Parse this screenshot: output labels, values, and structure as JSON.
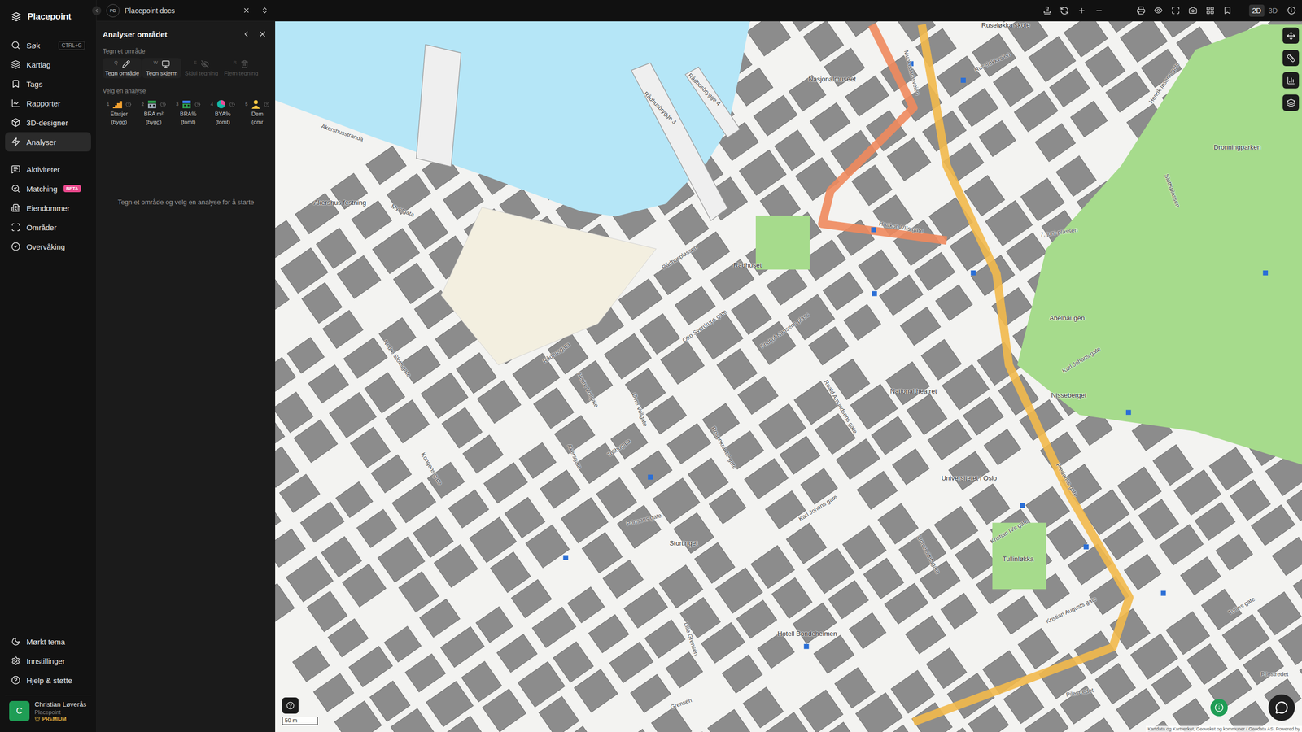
{
  "app": {
    "name": "Placepoint"
  },
  "sidebar": {
    "primary": [
      {
        "label": "Søk",
        "shortcut": "CTRL+G",
        "selected": false
      },
      {
        "label": "Kartlag",
        "selected": false
      },
      {
        "label": "Tags",
        "selected": false
      },
      {
        "label": "Rapporter",
        "selected": false
      },
      {
        "label": "3D-designer",
        "selected": false
      },
      {
        "label": "Analyser",
        "selected": true
      }
    ],
    "secondary": [
      {
        "label": "Aktiviteter",
        "selected": false
      },
      {
        "label": "Matching",
        "badge": "BETA",
        "selected": false
      },
      {
        "label": "Eiendommer",
        "selected": false
      },
      {
        "label": "Områder",
        "selected": false
      },
      {
        "label": "Overvåking",
        "selected": false
      }
    ],
    "bottom": [
      {
        "label": "Mørkt tema"
      },
      {
        "label": "Innstillinger"
      },
      {
        "label": "Hjelp & støtte"
      }
    ],
    "user": {
      "initial": "C",
      "name": "Christian Løverås",
      "organization": "Placepoint",
      "plan": "PREMIUM"
    }
  },
  "topbar": {
    "workspace": {
      "initials": "PD",
      "name": "Placepoint docs"
    },
    "view_modes": [
      {
        "label": "2D",
        "selected": true
      },
      {
        "label": "3D",
        "selected": false
      }
    ]
  },
  "panel": {
    "title": "Analyser området",
    "draw_section": "Tegn et område",
    "tools": [
      {
        "key": "Q",
        "label": "Tegn område",
        "disabled": false
      },
      {
        "key": "W",
        "label": "Tegn skjerm",
        "disabled": false
      },
      {
        "key": "E",
        "label": "Skjul tegning",
        "disabled": true
      },
      {
        "key": "R",
        "label": "Fjern tegning",
        "disabled": true
      }
    ],
    "analysis_section": "Velg en analyse",
    "analyses": [
      {
        "number": "1",
        "line1": "Etasjer",
        "line2": "(bygg)",
        "selected": false
      },
      {
        "number": "2",
        "line1": "BRA m²",
        "line2": "(bygg)",
        "selected": false
      },
      {
        "number": "3",
        "line1": "BRA%",
        "line2": "(tomt)",
        "selected": false
      },
      {
        "number": "4",
        "line1": "BYA%",
        "line2": "(tomt)",
        "selected": false
      },
      {
        "number": "5",
        "line1": "Dem",
        "line2": "(omr",
        "selected": false
      }
    ],
    "empty_message": "Tegn et område og velg en analyse for å starte"
  },
  "map": {
    "labels": [
      {
        "text": "Ruseløkka skole",
        "kind": "place"
      },
      {
        "text": "Nasjonalmuseet",
        "kind": "place"
      },
      {
        "text": "Munkedamsveien",
        "kind": "street"
      },
      {
        "text": "Ruseløkkveien",
        "kind": "street"
      },
      {
        "text": "Henrik Ibsens gate",
        "kind": "street"
      },
      {
        "text": "Dronningparken",
        "kind": "place"
      },
      {
        "text": "Slottsplassen",
        "kind": "street"
      },
      {
        "text": "7. juni-plassen",
        "kind": "street"
      },
      {
        "text": "Haakon VIIs gate",
        "kind": "street"
      },
      {
        "text": "Akershusstranda",
        "kind": "street"
      },
      {
        "text": "Rådhusbrygge 3",
        "kind": "street"
      },
      {
        "text": "Rådhusbrygge 4",
        "kind": "street"
      },
      {
        "text": "Akershus festning",
        "kind": "place"
      },
      {
        "text": "Myntgata",
        "kind": "street"
      },
      {
        "text": "Rådhusplassen",
        "kind": "street"
      },
      {
        "text": "Rådhuset",
        "kind": "place"
      },
      {
        "text": "Fridtjof Nansens plass",
        "kind": "street"
      },
      {
        "text": "Otto Sverdrups gate",
        "kind": "street"
      },
      {
        "text": "Rådhusgata",
        "kind": "street"
      },
      {
        "text": "Nedre Slottsgate",
        "kind": "street"
      },
      {
        "text": "Nedre Vollgate",
        "kind": "street"
      },
      {
        "text": "Øvre Vollgate",
        "kind": "street"
      },
      {
        "text": "Roald Amundsens gate",
        "kind": "street"
      },
      {
        "text": "Nationaltheatret",
        "kind": "place"
      },
      {
        "text": "Abelhaugen",
        "kind": "place"
      },
      {
        "text": "Nisseberget",
        "kind": "place"
      },
      {
        "text": "Karl Johans gate",
        "kind": "street"
      },
      {
        "text": "Tollbugata",
        "kind": "street"
      },
      {
        "text": "Kongens gate",
        "kind": "street"
      },
      {
        "text": "Universitetet i Oslo",
        "kind": "place"
      },
      {
        "text": "Frederiks gate",
        "kind": "street"
      },
      {
        "text": "Karl Johans gate",
        "kind": "street"
      },
      {
        "text": "Prinsens gate",
        "kind": "street"
      },
      {
        "text": "Kristian IVs gate",
        "kind": "street"
      },
      {
        "text": "Stortinget",
        "kind": "place"
      },
      {
        "text": "Tullinløkka",
        "kind": "place"
      },
      {
        "text": "Universitetsgata",
        "kind": "street"
      },
      {
        "text": "Rosenkrantz' gate",
        "kind": "street"
      },
      {
        "text": "Akersgata",
        "kind": "street"
      },
      {
        "text": "Lille Grensen",
        "kind": "street"
      },
      {
        "text": "Hotell Bondeheimen",
        "kind": "place"
      },
      {
        "text": "Tullins gate",
        "kind": "street"
      },
      {
        "text": "Kristian Augusts gate",
        "kind": "street"
      },
      {
        "text": "Pilestredet",
        "kind": "street"
      },
      {
        "text": "Pilestredet",
        "kind": "street"
      },
      {
        "text": "Grensen",
        "kind": "street"
      }
    ],
    "scale": "50 m",
    "attribution": "Kartdata og Kartverket, Geovekst og kommuner / Geodata AS, Powered by"
  }
}
